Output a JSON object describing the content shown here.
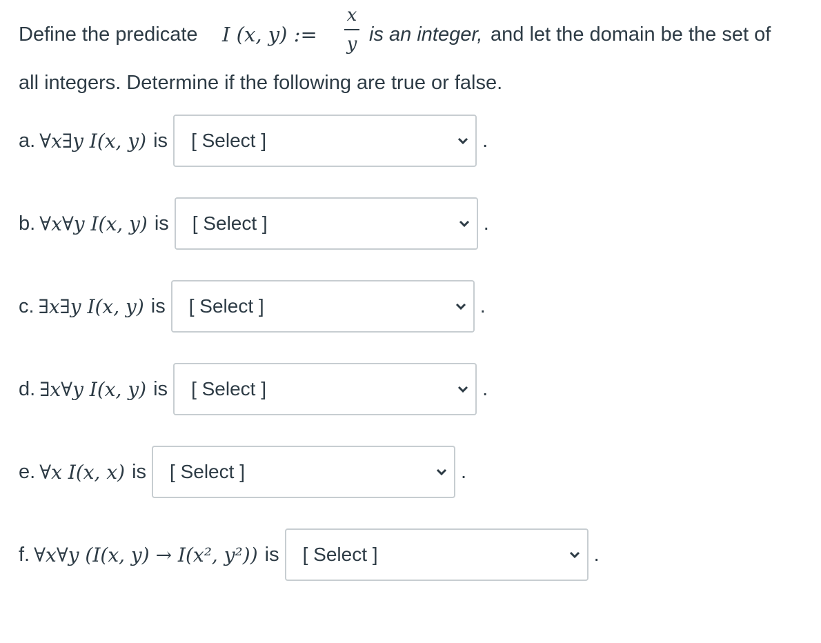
{
  "intro": {
    "define": "Define the predicate",
    "predicate": "I (x, y) :=",
    "fraction_num": "x",
    "fraction_den": "y",
    "is_integer": "is an integer,",
    "rest_line1": "and let the domain be the set of",
    "line2": "all integers.  Determine if the following are true or false."
  },
  "questions": [
    {
      "letter": "a.",
      "expr": "∀x∃y I(x, y)",
      "is": "is",
      "select": "[ Select ]",
      "end": "."
    },
    {
      "letter": "b.",
      "expr": "∀x∀y I(x, y)",
      "is": "is",
      "select": "[ Select ]",
      "end": "."
    },
    {
      "letter": "c.",
      "expr": "∃x∃y I(x, y)",
      "is": "is",
      "select": "[ Select ]",
      "end": "."
    },
    {
      "letter": "d.",
      "expr": "∃x∀y I(x, y)",
      "is": "is",
      "select": "[ Select ]",
      "end": "."
    },
    {
      "letter": "e.",
      "expr": "∀x I(x, x)",
      "is": "is",
      "select": "[ Select ]",
      "end": "."
    },
    {
      "letter": "f.",
      "expr": "∀x∀y (I(x, y) → I(x², y²))",
      "is": "is",
      "select": "[ Select ]",
      "end": "."
    }
  ],
  "icons": {
    "select_arrow": "chevron-down-icon"
  }
}
